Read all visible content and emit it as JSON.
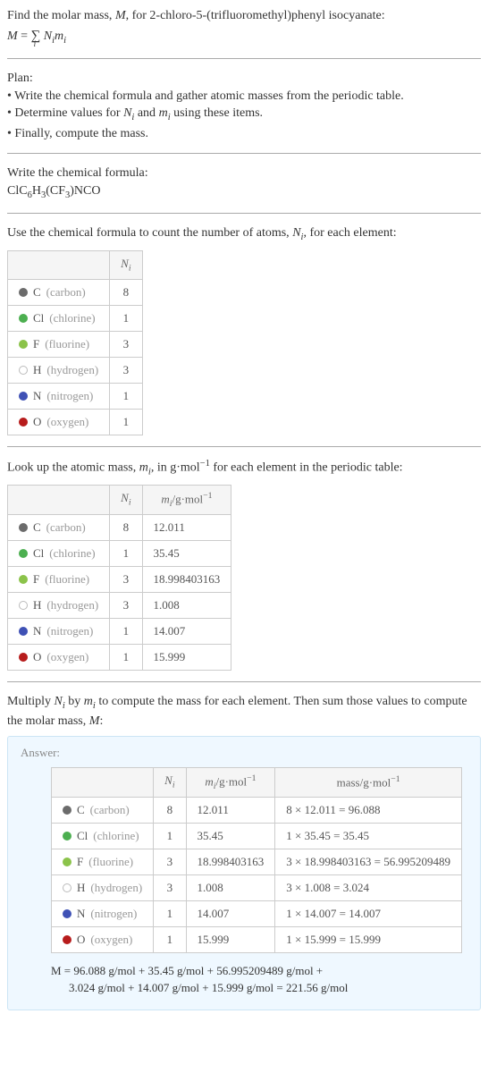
{
  "intro": {
    "line1_a": "Find the molar mass, ",
    "line1_b": ", for 2-chloro-5-(trifluoromethyl)phenyl isocyanate:",
    "eq_lhs": "M",
    "eq_rhs_pre": " = ",
    "eq_sum": "∑",
    "eq_sub": "i",
    "eq_Ni": " N",
    "eq_mi": "m"
  },
  "plan": {
    "heading": "Plan:",
    "l1": "• Write the chemical formula and gather atomic masses from the periodic table.",
    "l2_a": "• Determine values for ",
    "l2_b": " and ",
    "l2_c": " using these items.",
    "l3": "• Finally, compute the mass."
  },
  "write": {
    "heading": "Write the chemical formula:",
    "formula_parts": [
      "ClC",
      "6",
      "H",
      "3",
      "(CF",
      "3",
      ")NCO"
    ]
  },
  "count": {
    "heading_a": "Use the chemical formula to count the number of atoms, ",
    "heading_b": ", for each element:",
    "col_N": "N",
    "col_i": "i"
  },
  "elements": [
    {
      "sym": "C",
      "name": "carbon",
      "n": "8",
      "color": "#6b6b6b",
      "mass": "12.011",
      "calc": "8 × 12.011 = 96.088"
    },
    {
      "sym": "Cl",
      "name": "chlorine",
      "n": "1",
      "color": "#4caf50",
      "mass": "35.45",
      "calc": "1 × 35.45 = 35.45"
    },
    {
      "sym": "F",
      "name": "fluorine",
      "n": "3",
      "color": "#8bc34a",
      "mass": "18.998403163",
      "calc": "3 × 18.998403163 = 56.995209489"
    },
    {
      "sym": "H",
      "name": "hydrogen",
      "n": "3",
      "color": "#ffffff",
      "mass": "1.008",
      "calc": "3 × 1.008 = 3.024"
    },
    {
      "sym": "N",
      "name": "nitrogen",
      "n": "1",
      "color": "#3f51b5",
      "mass": "14.007",
      "calc": "1 × 14.007 = 14.007"
    },
    {
      "sym": "O",
      "name": "oxygen",
      "n": "1",
      "color": "#b71c1c",
      "mass": "15.999",
      "calc": "1 × 15.999 = 15.999"
    }
  ],
  "lookup": {
    "heading_a": "Look up the atomic mass, ",
    "heading_b": ", in g·mol",
    "heading_c": " for each element in the periodic table:",
    "mcol_a": "m",
    "mcol_b": "/g·mol",
    "neg1": "−1"
  },
  "multiply": {
    "line_a": "Multiply ",
    "line_b": " by ",
    "line_c": " to compute the mass for each element. Then sum those values to compute the molar mass, ",
    "line_d": ":"
  },
  "answer": {
    "label": "Answer:",
    "masscol_a": "mass/g·mol",
    "final1": "M = 96.088 g/mol + 35.45 g/mol + 56.995209489 g/mol +",
    "final2": "3.024 g/mol + 14.007 g/mol + 15.999 g/mol = 221.56 g/mol"
  }
}
